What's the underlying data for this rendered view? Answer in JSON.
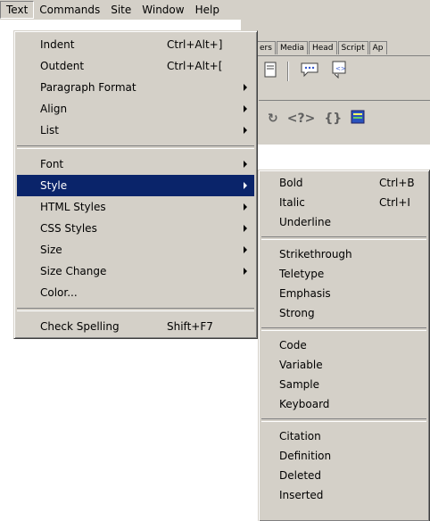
{
  "menubar": {
    "items": [
      "Text",
      "Commands",
      "Site",
      "Window",
      "Help"
    ]
  },
  "insert_bar": {
    "tabs": [
      "ers",
      "Media",
      "Head",
      "Script",
      "Ap"
    ]
  },
  "text_menu": {
    "items": [
      {
        "label": "Indent",
        "shortcut": "Ctrl+Alt+]"
      },
      {
        "label": "Outdent",
        "shortcut": "Ctrl+Alt+["
      },
      {
        "label": "Paragraph Format"
      },
      {
        "label": "Align"
      },
      {
        "label": "List"
      },
      {
        "label": "Font"
      },
      {
        "label": "Style"
      },
      {
        "label": "HTML Styles"
      },
      {
        "label": "CSS Styles"
      },
      {
        "label": "Size"
      },
      {
        "label": "Size Change"
      },
      {
        "label": "Color..."
      },
      {
        "label": "Check Spelling",
        "shortcut": "Shift+F7"
      }
    ]
  },
  "style_menu": {
    "items": [
      {
        "label": "Bold",
        "shortcut": "Ctrl+B"
      },
      {
        "label": "Italic",
        "shortcut": "Ctrl+I"
      },
      {
        "label": "Underline"
      },
      {
        "label": "Strikethrough"
      },
      {
        "label": "Teletype"
      },
      {
        "label": "Emphasis"
      },
      {
        "label": "Strong"
      },
      {
        "label": "Code"
      },
      {
        "label": "Variable"
      },
      {
        "label": "Sample"
      },
      {
        "label": "Keyboard"
      },
      {
        "label": "Citation"
      },
      {
        "label": "Definition"
      },
      {
        "label": "Deleted"
      },
      {
        "label": "Inserted"
      }
    ]
  },
  "colors": {
    "selection": "#0a246a",
    "menu_face": "#d4d0c8"
  }
}
